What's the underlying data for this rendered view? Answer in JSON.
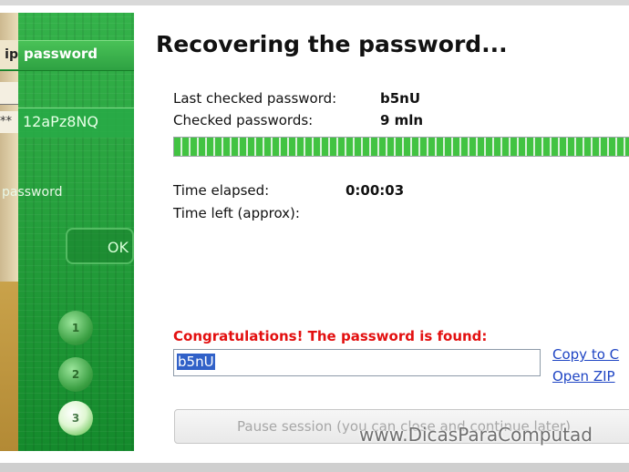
{
  "sidebar": {
    "tab_fragment": "ip",
    "title": "password",
    "masked_fragment": "**",
    "password_value": "12aPz8NQ",
    "label": "password",
    "ok_label": "OK",
    "steps": [
      "1",
      "2",
      "3"
    ],
    "active_step": 3
  },
  "main": {
    "title": "Recovering the password...",
    "last_checked_label": "Last checked password:",
    "last_checked_value": "b5nU",
    "checked_label": "Checked passwords:",
    "checked_value": "9 mln",
    "progress_fraction": 1.0,
    "time_elapsed_label": "Time elapsed:",
    "time_elapsed_value": "0:00:03",
    "time_left_label": "Time left (approx):",
    "time_left_value": "",
    "congrats_text": "Congratulations! The password is found:",
    "found_password": "b5nU",
    "copy_link": "Copy to C",
    "open_zip_link": "Open ZIP",
    "pause_button": "Pause session (you can close and continue later)"
  },
  "watermark": "www.DicasParaComputad",
  "colors": {
    "accent_green": "#1f9b3a",
    "progress_green": "#42c342",
    "congrats_red": "#e31010",
    "link_blue": "#1f45c4",
    "selection_blue": "#3161c8"
  }
}
